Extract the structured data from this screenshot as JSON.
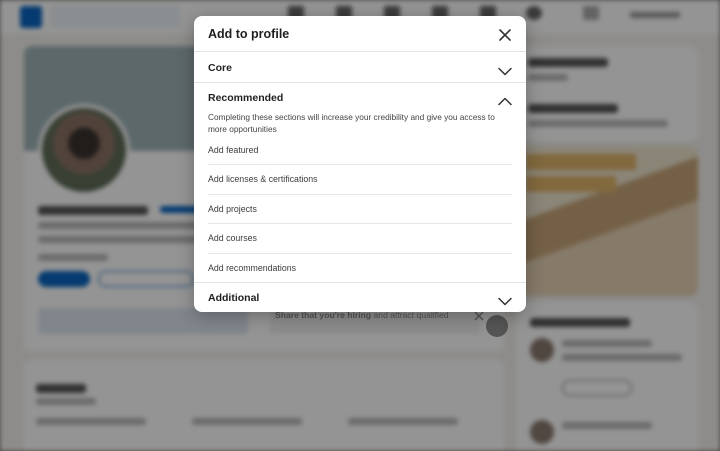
{
  "modal": {
    "title": "Add to profile",
    "sections": {
      "core": {
        "label": "Core",
        "expanded": false
      },
      "recommended": {
        "label": "Recommended",
        "expanded": true,
        "description": "Completing these sections will increase your credibility and give you access to more opportunities",
        "items": [
          {
            "label": "Add featured"
          },
          {
            "label": "Add licenses & certifications"
          },
          {
            "label": "Add projects"
          },
          {
            "label": "Add courses"
          },
          {
            "label": "Add recommendations"
          }
        ]
      },
      "additional": {
        "label": "Additional",
        "expanded": false
      }
    }
  },
  "background": {
    "hiring_prompt": {
      "bold": "Share that you're hiring",
      "rest": " and attract qualified"
    }
  },
  "colors": {
    "accent": "#0a66c2",
    "overlay": "rgba(0,0,0,0.42)",
    "modal_bg": "#ffffff"
  }
}
